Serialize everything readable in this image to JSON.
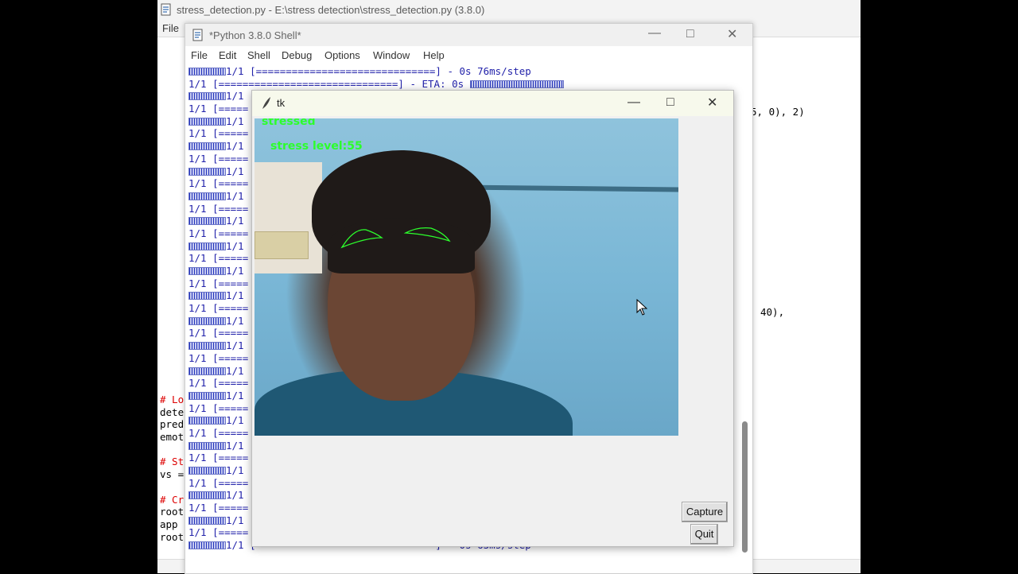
{
  "editor": {
    "title": "stress_detection.py - E:\\stress detection\\stress_detection.py (3.8.0)",
    "menu_file": "File",
    "code_right_1": "5, 0), 2)",
    "code_right_2": "40),",
    "code_left": [
      {
        "text": "# Lo",
        "kind": "comment"
      },
      {
        "text": "dete",
        "kind": "plain"
      },
      {
        "text": "pred",
        "kind": "plain"
      },
      {
        "text": "emot",
        "kind": "plain"
      },
      {
        "text": "",
        "kind": "plain"
      },
      {
        "text": "# St",
        "kind": "comment"
      },
      {
        "text": "vs =",
        "kind": "plain"
      },
      {
        "text": "",
        "kind": "plain"
      },
      {
        "text": "# Cr",
        "kind": "comment"
      },
      {
        "text": "root",
        "kind": "plain"
      },
      {
        "text": "app ",
        "kind": "plain"
      },
      {
        "text": "root",
        "kind": "plain"
      }
    ]
  },
  "shell": {
    "title": "*Python 3.8.0 Shell*",
    "menu": [
      "File",
      "Edit",
      "Shell",
      "Debug",
      "Options",
      "Window",
      "Help"
    ],
    "first_line": "1/1 [==============================] - 0s 76ms/step",
    "second_line": "1/1 [==============================] - ETA: 0s",
    "repeated_prefix": "1/1",
    "repeated_line": "1/1 [=====",
    "last_line": "1/1 [==============================] - 0s 63ms/step"
  },
  "tk": {
    "title": "tk",
    "overlay_status": "stressed",
    "overlay_level": "stress level:55",
    "capture_label": "Capture",
    "quit_label": "Quit"
  },
  "colors": {
    "overlay_green": "#2cff2c",
    "comment_red": "#dd0000",
    "shell_blue": "#2222aa"
  }
}
